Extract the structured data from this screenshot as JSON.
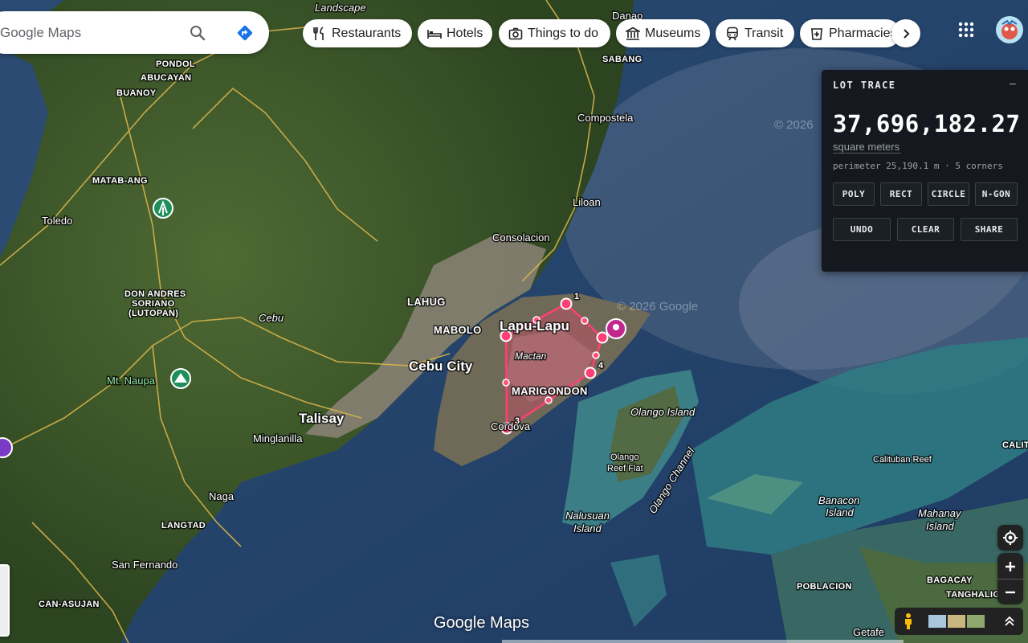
{
  "search": {
    "text": "Google Maps"
  },
  "chips": [
    {
      "label": "Restaurants",
      "icon": "fork-knife-icon"
    },
    {
      "label": "Hotels",
      "icon": "bed-icon"
    },
    {
      "label": "Things to do",
      "icon": "camera-icon"
    },
    {
      "label": "Museums",
      "icon": "museum-icon"
    },
    {
      "label": "Transit",
      "icon": "train-icon"
    },
    {
      "label": "Pharmacies",
      "icon": "pharmacy-icon"
    }
  ],
  "panel": {
    "title": "LOT TRACE",
    "minimize": "–",
    "area": "37,696,182.27",
    "unit": "square meters",
    "meta": "perimeter 25,190.1 m · 5 corners",
    "mode_buttons": [
      "POLY",
      "RECT",
      "CIRCLE",
      "N-GON"
    ],
    "action_buttons": [
      "UNDO",
      "CLEAR",
      "SHARE"
    ]
  },
  "map": {
    "top_labels": {
      "landscape": "Landscape",
      "danao": "Danao",
      "sabang": "SABANG",
      "compostela": "Compostela"
    },
    "places": {
      "pondol": "PONDOL",
      "abucayan": "ABUCAYAN",
      "buanoy": "BUANOY",
      "matab_ang": "MATAB-ANG",
      "toledo": "Toledo",
      "don_andres_1": "DON ANDRES",
      "don_andres_2": "SORIANO",
      "don_andres_3": "(LUTOPAN)",
      "cebu": "Cebu",
      "mt_naupa": "Mt. Naupa",
      "liloan": "Liloan",
      "consolacion": "Consolacion",
      "lahug": "LAHUG",
      "mabolo": "MABOLO",
      "lapu_lapu": "Lapu-Lapu",
      "mactan": "Mactan",
      "cebu_city": "Cebu City",
      "marigondon": "MARIGONDON",
      "cordova": "Cordova",
      "talisay": "Talisay",
      "minglanilla": "Minglanilla",
      "naga": "Naga",
      "langtad": "LANGTAD",
      "san_fernando": "San Fernando",
      "can_asujan": "CAN-ASUJAN",
      "olango_island": "Olango Island",
      "olango_reef_1": "Olango",
      "olango_reef_2": "Reef Flat",
      "olango_channel": "Olango Channel",
      "nalusuan_1": "Nalusuan",
      "nalusuan_2": "Island",
      "calituban": "Calituban Reef",
      "banacon_1": "Banacon",
      "banacon_2": "Island",
      "mahanay_1": "Mahanay",
      "mahanay_2": "Island",
      "calit": "CALIT",
      "poblacion": "POBLACION",
      "bagacay": "BAGACAY",
      "tanghalig": "TANGHALIG",
      "getafe": "Getafe",
      "watermark": "© 2026",
      "watermark2": "© 2026 Google"
    },
    "vertices": [
      "1",
      "2",
      "3",
      "4",
      "5"
    ]
  },
  "brand": "Google Maps"
}
